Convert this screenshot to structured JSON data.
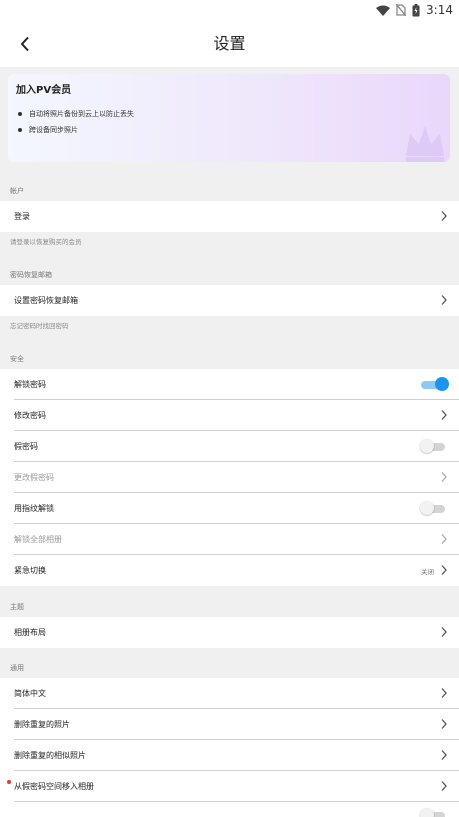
{
  "status_bar": {
    "time": "3:14"
  },
  "header": {
    "title": "设置"
  },
  "vip": {
    "title": "加入PV会员",
    "bullets": [
      "自动将照片备份到云上以防止丢失",
      "跨设备同步照片"
    ]
  },
  "sections": {
    "account": {
      "label": "帐户",
      "login": "登录",
      "note": "请登录以恢复购买的会员"
    },
    "recovery": {
      "label": "密码恢复邮箱",
      "set_email": "设置密码恢复邮箱",
      "note": "忘记密码时找回密码"
    },
    "security": {
      "label": "安全",
      "unlock_password": "解锁密码",
      "unlock_password_on": true,
      "change_password": "修改密码",
      "fake_password": "假密码",
      "fake_password_on": false,
      "change_fake_password": "更改假密码",
      "fingerprint_unlock": "用指纹解锁",
      "fingerprint_on": false,
      "unlock_all_albums": "解锁全部相册",
      "emergency_switch": "紧急切换",
      "emergency_value": "关闭"
    },
    "theme": {
      "label": "主题",
      "album_layout": "相册布局"
    },
    "general": {
      "label": "通用",
      "language": "简体中文",
      "delete_duplicates": "删除重复的照片",
      "delete_similar": "删除重复的相似照片",
      "move_from_fake": "从假密码空间移入相册"
    }
  },
  "colors": {
    "accent": "#1b95ee",
    "divider": "#d0d0d0",
    "background": "#f0f0f0"
  }
}
